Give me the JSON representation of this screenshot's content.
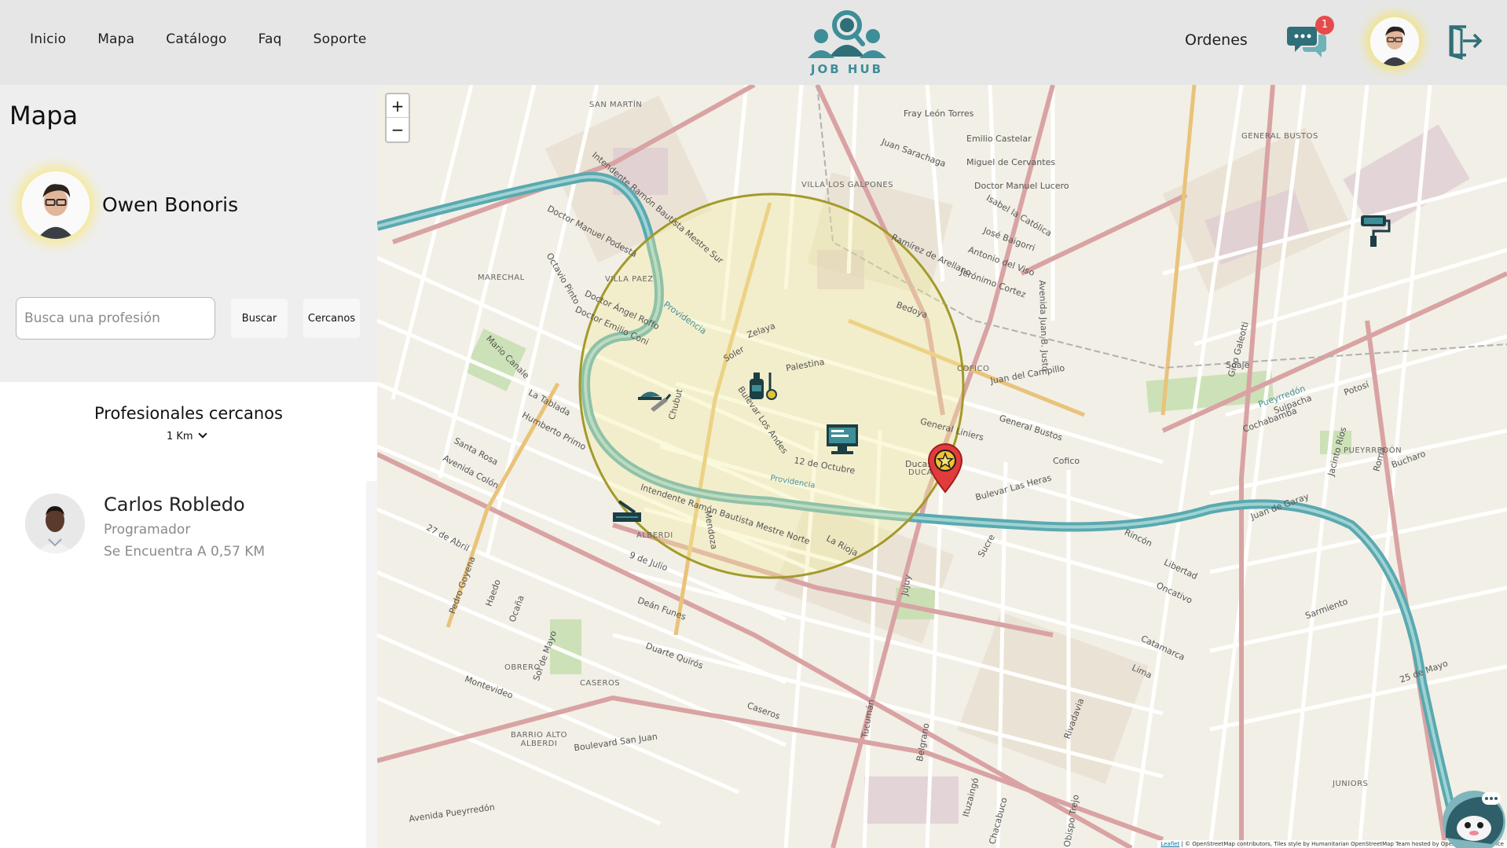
{
  "nav": {
    "items": [
      "Inicio",
      "Mapa",
      "Catálogo",
      "Faq",
      "Soporte"
    ]
  },
  "logo": {
    "text": "JOB HUB"
  },
  "header": {
    "orders_label": "Ordenes",
    "chat_badge": "1"
  },
  "sidebar": {
    "title": "Mapa",
    "user_name": "Owen Bonoris",
    "search": {
      "placeholder": "Busca una profesión",
      "value": ""
    },
    "search_button": "Buscar",
    "nearby_button": "Cercanos",
    "nearby_title": "Profesionales cercanos",
    "radius_selected": "1 Km",
    "professionals": [
      {
        "name": "Carlos Robledo",
        "role": "Programador",
        "distance": "Se Encuentra A 0,57 KM"
      }
    ]
  },
  "map": {
    "zoom_in": "+",
    "zoom_out": "−",
    "attribution_prefix": "Leaflet",
    "attribution": "| © OpenStreetMap contributors, Tiles style by Humanitarian OpenStreetMap Team hosted by OpenStreetMap France",
    "street_labels": [
      "Intendente Ramón Bautista Mestre Sur",
      "Intendente Ramón Bautista Mestre Norte",
      "Doctor Manuel Podestá",
      "Doctor Ángel Roffo",
      "Doctor Emilio Coni",
      "12 de Octubre",
      "La Tablada",
      "Humberto Primo",
      "La Rioja",
      "Santa Rosa",
      "Avenida Colón",
      "27 de Abril",
      "Deán Funes",
      "9 de Julio",
      "Duarte Quirós",
      "Caseros",
      "Avenida Pueyrredón",
      "Boulevard San Juan",
      "Montevideo",
      "Zelaya",
      "Bedoya",
      "Palestina",
      "General Liniers",
      "General Bustos",
      "Juan del Campillo",
      "Sucre",
      "Bulevar Las Heras",
      "Bulevar Los Andes",
      "Ducasse",
      "Cofico",
      "Rivadavia",
      "Libertad",
      "Oncativo",
      "Catamarca",
      "Lima",
      "Jujuy",
      "Tucumán",
      "Belgrano",
      "Rincón",
      "Ituzaingó",
      "Chacabuco",
      "Obispo Trejo",
      "Chubut",
      "Providencia",
      "Mendoza",
      "Soler",
      "Fray León Torres",
      "Emilio Castelar",
      "Miguel de Cervantes",
      "Doctor Manuel Lucero",
      "Isabel la Católica",
      "José Baigorri",
      "Antonio del Viso",
      "Jerónimo Cortez",
      "Ramírez de Arellano",
      "Juan Sarachaga",
      "Sol de Mayo",
      "Ocaña",
      "Haedo",
      "Pedro Goyena",
      "Mario Canale",
      "Octavio Pinto",
      "Avenida Juan B. Justo",
      "Potosí",
      "Cochabamba",
      "Sarmiento",
      "25 de Mayo",
      "Jacinto Ríos",
      "Roma",
      "Juan de Garay",
      "Bucharo",
      "Gino Galeotti",
      "Soaje",
      "Suipacha",
      "Pueyrredón"
    ],
    "area_labels": [
      "SAN MARTÍN",
      "VILLA LOS GALPONES",
      "GENERAL BUSTOS",
      "MARECHAL",
      "VILLA PAEZ",
      "COFICO",
      "ALBERDI",
      "BARRIO ALTO ALBERDI",
      "CASEROS",
      "OBRERO",
      "JUNIORS",
      "PUEYRREDÓN",
      "DUCASSE"
    ],
    "river_label": "Providencia"
  },
  "colors": {
    "header_bg": "#e6e6e6",
    "panel_bg": "#eeeeee",
    "brand_teal": "#3e8e98",
    "badge_red": "#e64b4b",
    "avatar_glow": "#f4e37a",
    "radius_circle": "#a39a2b",
    "river": "#5aa9b0",
    "marker_red": "#e23b3b"
  },
  "icons": {
    "chat": "chat-bubbles-icon",
    "logout": "logout-icon",
    "marker": "star-location-pin-icon",
    "worker_markers": [
      "mason-trowel-icon",
      "plumber-tools-icon",
      "programmer-computer-icon",
      "carpenter-icon",
      "painter-roller-icon"
    ],
    "mascot": "chatbot-mascot-icon"
  }
}
